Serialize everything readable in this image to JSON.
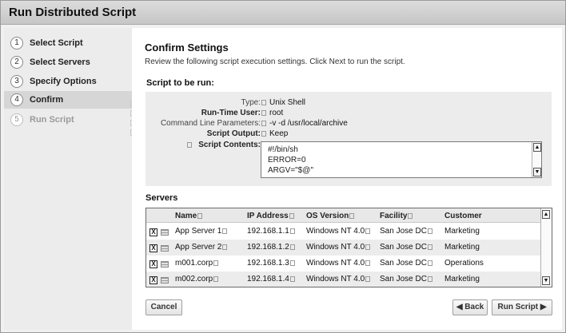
{
  "window": {
    "title": "Run Distributed Script"
  },
  "steps": [
    {
      "num": "1",
      "label": "Select Script"
    },
    {
      "num": "2",
      "label": "Select Servers"
    },
    {
      "num": "3",
      "label": "Specify Options"
    },
    {
      "num": "4",
      "label": "Confirm"
    },
    {
      "num": "5",
      "label": "Run Script"
    }
  ],
  "main": {
    "heading": "Confirm Settings",
    "description": "Review the following script execution settings. Click Next to run the script.",
    "script_heading": "Script to be run:",
    "servers_heading": "Servers"
  },
  "settings": [
    {
      "label": "Type:",
      "value": "Unix Shell"
    },
    {
      "label": "Run-Time User:",
      "value": "root"
    },
    {
      "label": "Command Line Parameters:",
      "value": "-v -d /usr/local/archive"
    },
    {
      "label": "Script Output:",
      "value": "Keep"
    },
    {
      "label": "Script Contents:",
      "value": ""
    }
  ],
  "script_contents": [
    "#!/bin/sh",
    "ERROR=0",
    "ARGV=\"$@\""
  ],
  "servers": {
    "columns": [
      "Name",
      "IP Address",
      "OS Version",
      "Facility",
      "Customer"
    ],
    "rows": [
      {
        "checked": "X",
        "name": "App Server 1",
        "ip": "192.168.1.1",
        "os": "Windows NT 4.0",
        "facility": "San Jose DC",
        "customer": "Marketing"
      },
      {
        "checked": "X",
        "name": "App Server 2",
        "ip": "192.168.1.2",
        "os": "Windows NT 4.0",
        "facility": "San Jose DC",
        "customer": "Marketing"
      },
      {
        "checked": "X",
        "name": "m001.corp",
        "ip": "192.168.1.3",
        "os": "Windows NT 4.0",
        "facility": "San Jose DC",
        "customer": "Operations"
      },
      {
        "checked": "X",
        "name": "m002.corp",
        "ip": "192.168.1.4",
        "os": "Windows NT 4.0",
        "facility": "San Jose DC",
        "customer": "Marketing"
      }
    ]
  },
  "buttons": {
    "cancel": "Cancel",
    "back": "◀ Back",
    "run": "Run Script ▶"
  },
  "icons": {
    "scroll_up": "▲",
    "scroll_down": "▼"
  }
}
